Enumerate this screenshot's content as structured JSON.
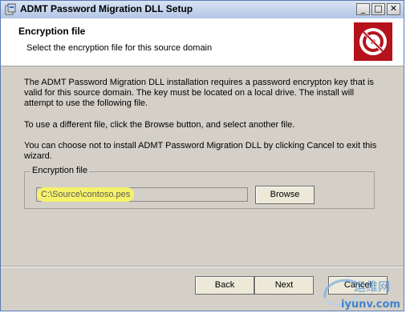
{
  "window": {
    "title": "ADMT Password Migration DLL Setup",
    "icon": "setup-icon",
    "controls": {
      "minimize": "_",
      "maximize": "□",
      "close": "✕"
    }
  },
  "header": {
    "title": "Encryption file",
    "subtitle": "Select the encryption file for this source domain",
    "logo": "disk-no-entry-icon"
  },
  "body": {
    "paragraph1": "The ADMT Password Migration DLL installation requires a password encrypton key that is valid for this source domain. The key must be located on a local drive. The install will attempt to use the following file.",
    "paragraph2": "To use a different file, click the Browse button, and select another file.",
    "paragraph3": "You can choose not to install ADMT Password Migration DLL by clicking Cancel to exit this wizard."
  },
  "encryption_group": {
    "label": "Encryption file",
    "file_value": "C:\\Source\\contoso.pes",
    "browse_label": "Browse"
  },
  "footer": {
    "back_label": "Back",
    "next_label": "Next",
    "cancel_label": "Cancel"
  },
  "watermark": {
    "brand": "运维网",
    "url": "iyunv.com"
  },
  "colors": {
    "dialog_bg": "#d4d0c8",
    "logo_red": "#b5121b",
    "highlight": "#f6f26a"
  }
}
